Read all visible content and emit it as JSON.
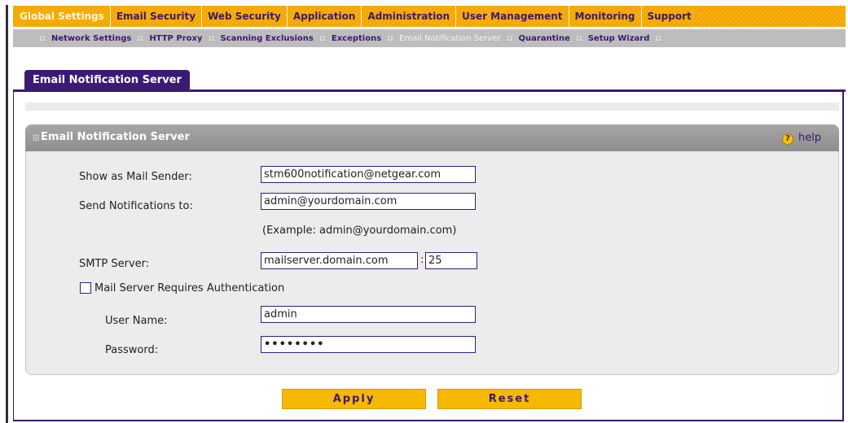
{
  "nav": {
    "main": [
      "Global Settings",
      "Email Security",
      "Web Security",
      "Application",
      "Administration",
      "User Management",
      "Monitoring",
      "Support"
    ],
    "active_main": "Global Settings",
    "sub": [
      "Network Settings",
      "HTTP Proxy",
      "Scanning Exclusions",
      "Exceptions",
      "Email Notification Server",
      "Quarantine",
      "Setup Wizard"
    ],
    "active_sub": "Email Notification Server",
    "separator": "::"
  },
  "tab": {
    "label": "Email Notification Server"
  },
  "panel": {
    "title": "Email Notification Server",
    "help_label": "help",
    "help_glyph": "?"
  },
  "form": {
    "mail_sender_label": "Show as Mail Sender:",
    "mail_sender_value": "stm600notification@netgear.com",
    "send_to_label": "Send Notifications to:",
    "send_to_value": "admin@yourdomain.com",
    "example_hint": "(Example: admin@yourdomain.com)",
    "smtp_label": "SMTP Server:",
    "smtp_server_value": "mailserver.domain.com",
    "smtp_port_sep": ":",
    "smtp_port_value": "25",
    "auth_checkbox_label": "Mail Server Requires Authentication",
    "auth_checked": false,
    "username_label": "User Name:",
    "username_value": "admin",
    "password_label": "Password:",
    "password_value": "••••••••"
  },
  "buttons": {
    "apply": "Apply",
    "reset": "Reset"
  },
  "colors": {
    "accent": "#3b1a74",
    "nav": "#f1a400",
    "button": "#f6b800"
  }
}
